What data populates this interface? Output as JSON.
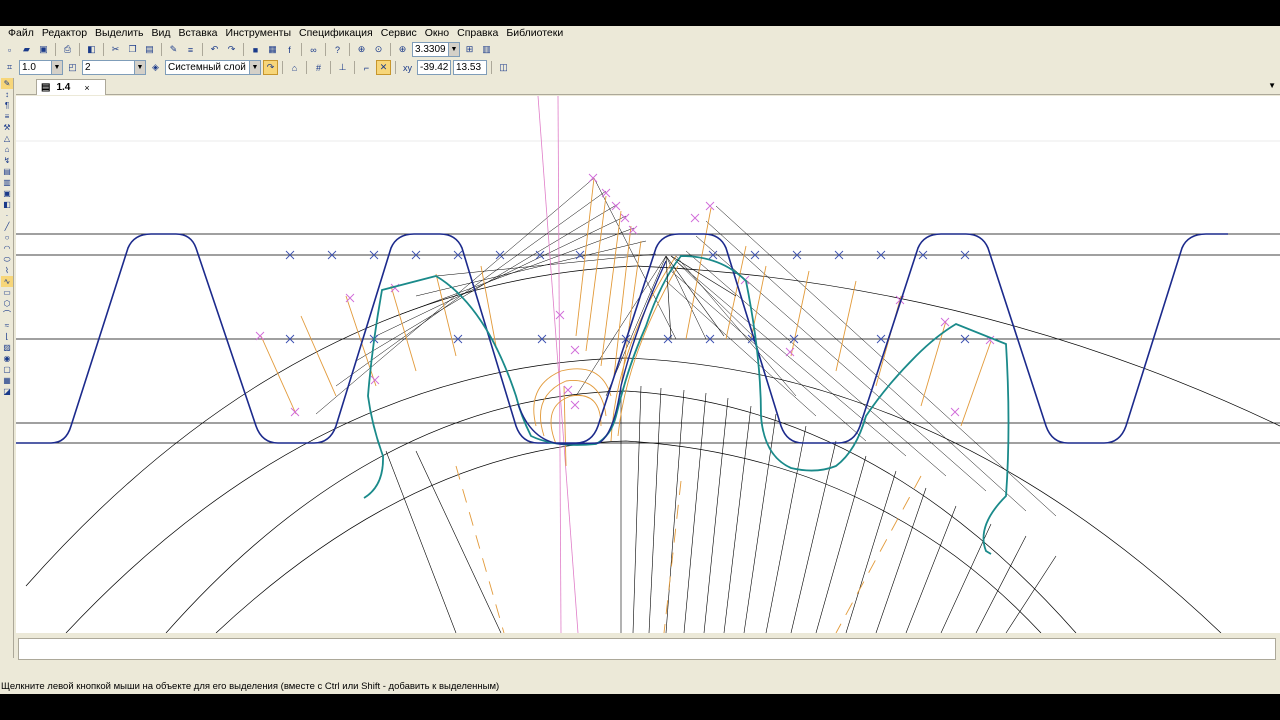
{
  "menu": {
    "items": [
      "Файл",
      "Редактор",
      "Выделить",
      "Вид",
      "Вставка",
      "Инструменты",
      "Спецификация",
      "Сервис",
      "Окно",
      "Справка",
      "Библиотеки"
    ]
  },
  "toolbar1": {
    "zoom_value": "3.3309"
  },
  "toolbar2": {
    "step_value": "1.0",
    "layer_number": "2",
    "layer_name": "Системный слой",
    "coord_x": "-39.42",
    "coord_y": "13.53"
  },
  "tab": {
    "label": "1.4",
    "close": "×"
  },
  "statusbar": {
    "hint": "Щелкните левой кнопкой мыши на объекте для его выделения (вместе с Ctrl или Shift - добавить к выделенным)"
  },
  "colors": {
    "gear_profile": "#1c2a8c",
    "conjugate_profile": "#1a8a8a",
    "construction_orange": "#e29a3a",
    "construction_pink": "#d870c8",
    "construction_black": "#000000",
    "highlight": "#f7d679"
  },
  "icons": [
    "new-icon",
    "open-icon",
    "save-icon",
    "print-icon",
    "preview-icon",
    "cut-icon",
    "copy-icon",
    "paste-icon",
    "properties-icon",
    "undo-icon",
    "redo-icon",
    "manager-icon",
    "library-icon",
    "variables-icon",
    "help-icon",
    "zoom-in-icon",
    "zoom-window-icon",
    "zoom-scale-icon",
    "fit-icon",
    "grid-icon",
    "ortho-icon",
    "snap-icon"
  ]
}
